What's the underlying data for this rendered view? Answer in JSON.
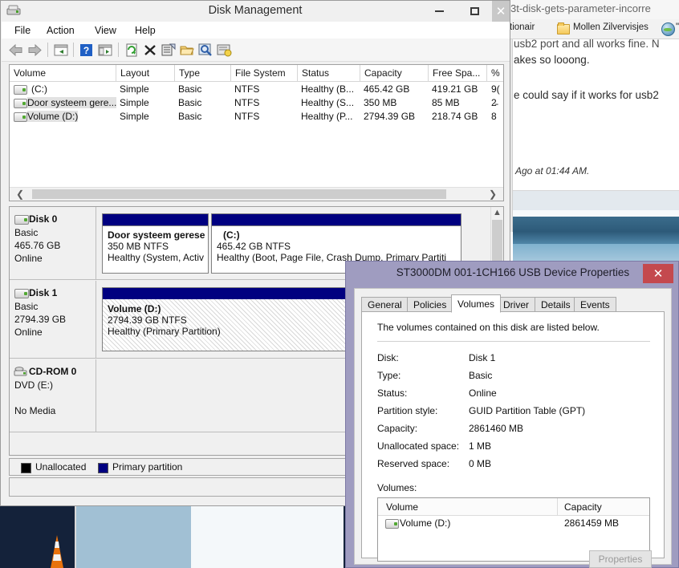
{
  "browser": {
    "url_fragment": "3t-disk-gets-parameter-incorre",
    "bookmarks": [
      {
        "label": "tionair",
        "icon": "none"
      },
      {
        "label": "Mollen Zilvervisjes",
        "icon": "folder-icon"
      },
      {
        "label": "\"M",
        "icon": "globe-icon"
      }
    ],
    "page_lines": [
      "usb2 port and all works fine. N",
      "akes so looong.",
      "e could say if it works for usb2",
      "Ago at 01:44 AM."
    ]
  },
  "disk_management": {
    "title": "Disk Management",
    "window_controls": {
      "minimize": "–",
      "maximize": "□",
      "close": "✕"
    },
    "menu": [
      "File",
      "Action",
      "View",
      "Help"
    ],
    "toolbar_icons": [
      "back-arrow-icon",
      "forward-arrow-icon",
      "show-hide-tree-icon",
      "help-icon",
      "properties-list-icon",
      "refresh-icon",
      "delete-icon",
      "new-window-icon",
      "open-folder-icon",
      "search-icon",
      "rescan-disks-icon"
    ],
    "volume_list": {
      "columns": [
        "Volume",
        "Layout",
        "Type",
        "File System",
        "Status",
        "Capacity",
        "Free Spa...",
        "%"
      ],
      "rows": [
        {
          "volume": "(C:)",
          "layout": "Simple",
          "type": "Basic",
          "fs": "NTFS",
          "status": "Healthy (B...",
          "capacity": "465.42 GB",
          "free": "419.21 GB",
          "pct": "9(",
          "selected": false
        },
        {
          "volume": "Door systeem gere...",
          "layout": "Simple",
          "type": "Basic",
          "fs": "NTFS",
          "status": "Healthy (S...",
          "capacity": "350 MB",
          "free": "85 MB",
          "pct": "2̵",
          "selected": true
        },
        {
          "volume": "Volume (D:)",
          "layout": "Simple",
          "type": "Basic",
          "fs": "NTFS",
          "status": "Healthy (P...",
          "capacity": "2794.39 GB",
          "free": "218.74 GB",
          "pct": "8",
          "selected": true
        }
      ]
    },
    "disks": [
      {
        "name": "Disk 0",
        "icon": "disk-icon",
        "type": "Basic",
        "size": "465.76 GB",
        "state": "Online",
        "partitions": [
          {
            "title": "Door systeem gerese",
            "size": "350 MB NTFS",
            "health": "Healthy (System, Activ",
            "selected": false
          },
          {
            "title": "(C:)",
            "size": "465.42 GB NTFS",
            "health": "Healthy (Boot, Page File, Crash Dump, Primary Partiti",
            "selected": false
          }
        ]
      },
      {
        "name": "Disk 1",
        "icon": "disk-icon",
        "type": "Basic",
        "size": "2794.39 GB",
        "state": "Online",
        "partitions": [
          {
            "title": "Volume  (D:)",
            "size": "2794.39 GB NTFS",
            "health": "Healthy (Primary Partition)",
            "selected": true
          }
        ]
      },
      {
        "name": "CD-ROM 0",
        "icon": "cdrom-icon",
        "type": "DVD (E:)",
        "size": "",
        "state": "No Media",
        "partitions": []
      }
    ],
    "legend": [
      {
        "label": "Unallocated",
        "color": "#000000"
      },
      {
        "label": "Primary partition",
        "color": "#000080"
      }
    ]
  },
  "properties_dialog": {
    "title": "ST3000DM 001-1CH166 USB Device Properties",
    "close_glyph": "✕",
    "close_color": "#c4494e",
    "titlebar_color": "#9f9cc0",
    "tabs": [
      {
        "label": "General",
        "active": false
      },
      {
        "label": "Policies",
        "active": false
      },
      {
        "label": "Volumes",
        "active": true
      },
      {
        "label": "Driver",
        "active": false
      },
      {
        "label": "Details",
        "active": false
      },
      {
        "label": "Events",
        "active": false
      }
    ],
    "intro": "The volumes contained on this disk are listed below.",
    "fields": [
      {
        "label": "Disk:",
        "value": "Disk 1"
      },
      {
        "label": "Type:",
        "value": "Basic"
      },
      {
        "label": "Status:",
        "value": "Online"
      },
      {
        "label": "Partition style:",
        "value": "GUID Partition Table (GPT)"
      },
      {
        "label": "Capacity:",
        "value": "2861460 MB"
      },
      {
        "label": "Unallocated space:",
        "value": "1 MB"
      },
      {
        "label": "Reserved space:",
        "value": "0 MB"
      }
    ],
    "volumes_label": "Volumes:",
    "volumes_table": {
      "columns": [
        "Volume",
        "Capacity"
      ],
      "rows": [
        {
          "volume": "Volume (D:)",
          "capacity": "2861459 MB"
        }
      ]
    },
    "properties_button": "Properties"
  }
}
